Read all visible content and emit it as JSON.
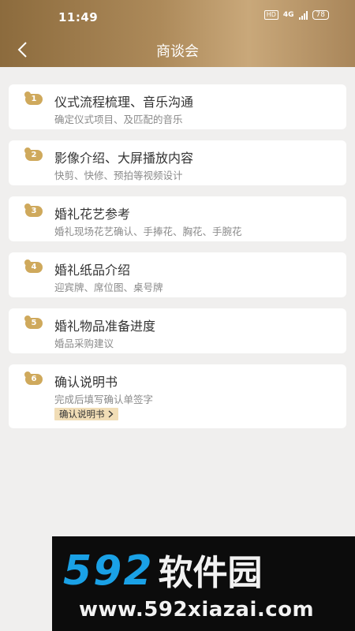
{
  "status": {
    "time": "11:49",
    "hd": "HD",
    "network": "4G",
    "battery": "78"
  },
  "nav": {
    "title": "商谈会"
  },
  "items": [
    {
      "num": "1",
      "title": "仪式流程梳理、音乐沟通",
      "subtitle": "确定仪式项目、及匹配的音乐"
    },
    {
      "num": "2",
      "title": "影像介绍、大屏播放内容",
      "subtitle": "快剪、快修、预拍等视频设计"
    },
    {
      "num": "3",
      "title": "婚礼花艺参考",
      "subtitle": "婚礼现场花艺确认、手捧花、胸花、手腕花"
    },
    {
      "num": "4",
      "title": "婚礼纸品介绍",
      "subtitle": "迎宾牌、席位图、桌号牌"
    },
    {
      "num": "5",
      "title": "婚礼物品准备进度",
      "subtitle": "婚品采购建议"
    },
    {
      "num": "6",
      "title": "确认说明书",
      "subtitle": "完成后填写确认单签字",
      "link": "确认说明书"
    }
  ],
  "watermark": {
    "digits": "592",
    "name": "软件园",
    "url": "www.592xiazai.com"
  },
  "colors": {
    "header_start": "#8c6b3d",
    "header_end": "#c9a87a",
    "badge": "#cfa95c",
    "link_bg": "#f1ddb6",
    "page_bg": "#f0efee"
  }
}
